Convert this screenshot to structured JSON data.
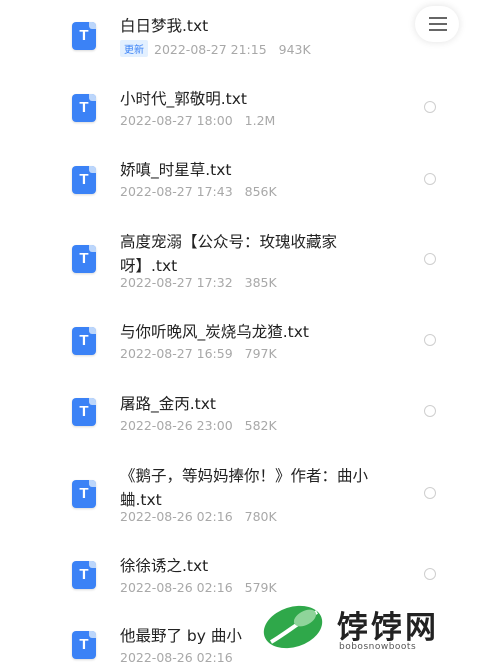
{
  "menu": {
    "icon": "hamburger-menu-icon"
  },
  "files": [
    {
      "name": "白日梦我.txt",
      "badge": "更新",
      "date": "2022-08-27 21:15",
      "size": "943K"
    },
    {
      "name": "小时代_郭敬明.txt",
      "date": "2022-08-27 18:00",
      "size": "1.2M"
    },
    {
      "name": "娇嗔_时星草.txt",
      "date": "2022-08-27 17:43",
      "size": "856K"
    },
    {
      "name": "高度宠溺【公众号：玫瑰收藏家呀】.txt",
      "date": "2022-08-27 17:32",
      "size": "385K"
    },
    {
      "name": "与你听晚风_炭烧乌龙猹.txt",
      "date": "2022-08-27 16:59",
      "size": "797K"
    },
    {
      "name": "屠路_金丙.txt",
      "date": "2022-08-26 23:00",
      "size": "582K"
    },
    {
      "name": "《鹅子，等妈妈捧你！》作者：曲小蛐.txt",
      "date": "2022-08-26 02:16",
      "size": "780K"
    },
    {
      "name": "徐徐诱之.txt",
      "date": "2022-08-26 02:16",
      "size": "579K"
    },
    {
      "name": "他最野了 by 曲小",
      "date": "2022-08-26 02:16",
      "size": ""
    }
  ],
  "icon_letter": "T",
  "watermark": {
    "title": "饽饽网",
    "subtitle": "bobosnowboots"
  },
  "colors": {
    "file_icon": "#3b82f6",
    "badge_bg": "#e3f0ff",
    "logo_green": "#2fa84a"
  }
}
